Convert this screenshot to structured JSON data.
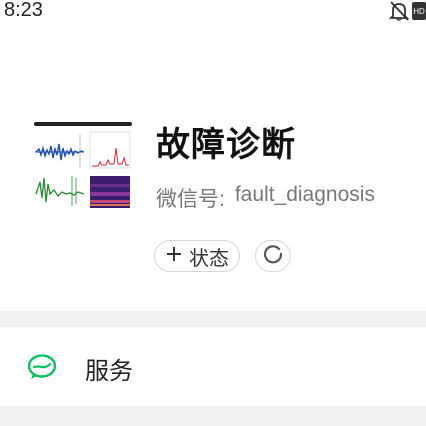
{
  "status_bar": {
    "time": "8:23",
    "icons": [
      "bell-off-icon",
      "hd-icon"
    ]
  },
  "profile": {
    "name": "故障诊断",
    "wechat_id_label": "微信号:",
    "wechat_id": "fault_diagnosis",
    "avatar_icon": "signal-spectrum-avatar"
  },
  "status": {
    "add_label": "状态",
    "add_icon": "plus-icon",
    "refresh_icon": "refresh-circle-icon"
  },
  "menu": {
    "services_label": "服务",
    "services_icon": "wechat-services-icon"
  },
  "colors": {
    "accent_green": "#07c160",
    "background": "#ffffff",
    "separator": "#f2f2f2",
    "secondary_text": "#777777"
  }
}
